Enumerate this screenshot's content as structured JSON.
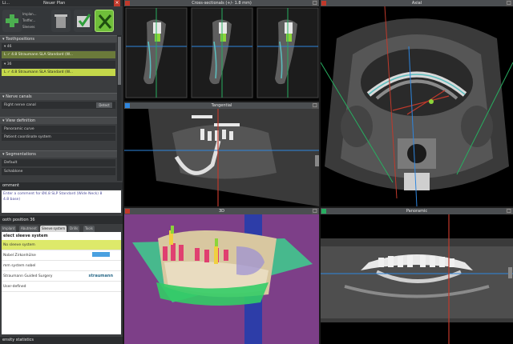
{
  "titlebar": {
    "title": "Li..."
  },
  "toolbar": {
    "new_plan": "Neuer Plan",
    "lines": [
      "Implan...",
      "Treffer...",
      "Sleeves"
    ]
  },
  "left": {
    "sections": {
      "tooth_positions": "Toothpositions",
      "nerve_canals": "Nerve canals",
      "view_definition": "View definition",
      "segmentations": "Segmentations"
    },
    "tooth_46": "46",
    "tooth_36": "36",
    "implant_46": "Straumann SLA Standard (W...",
    "implant_36": "Straumann SLA Standard (W...",
    "implant_46_prefix": "L  ✓  4.8",
    "implant_36_prefix": "L  ✓  4.8",
    "nerve_item": "Right nerve canal",
    "detect": "Detect",
    "view_items": [
      "Panoramic curve",
      "Patient coordinate system"
    ],
    "seg_items": [
      "Default",
      "Schablone"
    ]
  },
  "comment": {
    "title": "omment",
    "lines": [
      "Enter a comment for Ø4.8 SLP Standard (Wide Neck) 8",
      "4.8 base)"
    ]
  },
  "tooth_position": {
    "title": "ooth position 36",
    "tabs": [
      "Implant",
      "Abutment",
      "Sleeve system",
      "Drills",
      "Tools"
    ],
    "select_title": "elect sleeve system",
    "items": [
      {
        "label": "No sleeve system",
        "selected": true
      },
      {
        "label": "Nobel Zirkonhülse",
        "logo": ""
      },
      {
        "label": "mm system nobel",
        "logo": ""
      },
      {
        "label": "Straumann Guided Surgery",
        "logo": "straumann"
      },
      {
        "label": "User-defined",
        "logo": ""
      }
    ]
  },
  "density": {
    "title": "ensity statistics"
  },
  "viewports": {
    "cross": {
      "title": "Cross-sectionals (+/- 1.8 mm)",
      "color": "#c0392b"
    },
    "axial": {
      "title": "Axial",
      "color": "#c0392b"
    },
    "tangential": {
      "title": "Tangential",
      "color": "#2e86de"
    },
    "threed": {
      "title": "3D",
      "color": "#c0392b"
    },
    "panoramic": {
      "title": "Panoramic",
      "color": "#27ae60"
    }
  }
}
